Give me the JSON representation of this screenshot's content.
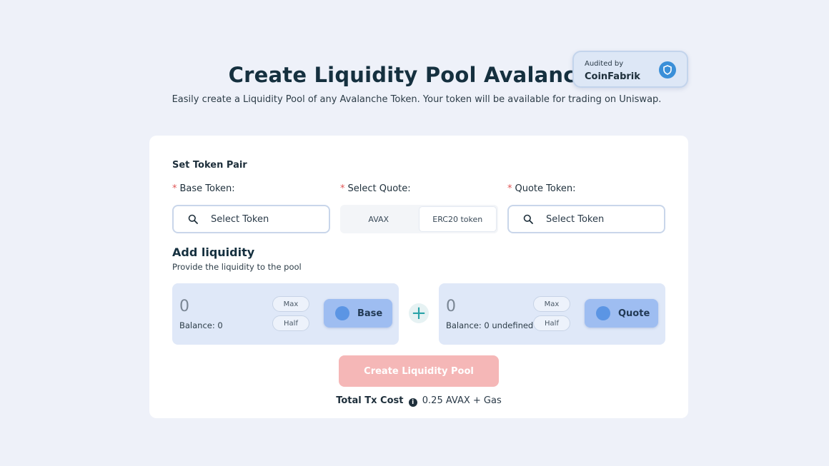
{
  "header": {
    "title": "Create Liquidity Pool Avalanche",
    "subtitle": "Easily create a Liquidity Pool of any Avalanche Token. Your token will be available for trading on Uniswap."
  },
  "audit": {
    "line1": "Audited by",
    "line2": "CoinFabrik",
    "icon": "shield-icon"
  },
  "token_pair": {
    "section_title": "Set Token Pair",
    "required_mark": "*",
    "base_label": "Base Token:",
    "base_placeholder": "Select Token",
    "quote_select_label": "Select Quote:",
    "quote_options": [
      "AVAX",
      "ERC20 token"
    ],
    "quote_selected": "ERC20 token",
    "quote_token_label": "Quote Token:",
    "quote_placeholder": "Select Token"
  },
  "liquidity": {
    "title": "Add liquidity",
    "description": "Provide the liquidity to the pool",
    "base": {
      "amount": "0",
      "balance": "Balance: 0",
      "max_label": "Max",
      "half_label": "Half",
      "token_label": "Base"
    },
    "plus": "+",
    "quote": {
      "amount": "0",
      "balance": "Balance: 0 undefined",
      "max_label": "Max",
      "half_label": "Half",
      "token_label": "Quote"
    }
  },
  "actions": {
    "create_label": "Create Liquidity Pool",
    "tx_cost_label": "Total Tx Cost",
    "info_icon": "i",
    "tx_cost_value": "0.25 AVAX + Gas"
  },
  "colors": {
    "page_bg": "#eef1f9",
    "title": "#15303f",
    "create_button_disabled": "#f5b7b7",
    "token_button": "#9ebdf1",
    "accent_teal": "#2aa3a8",
    "required": "#e05555"
  }
}
